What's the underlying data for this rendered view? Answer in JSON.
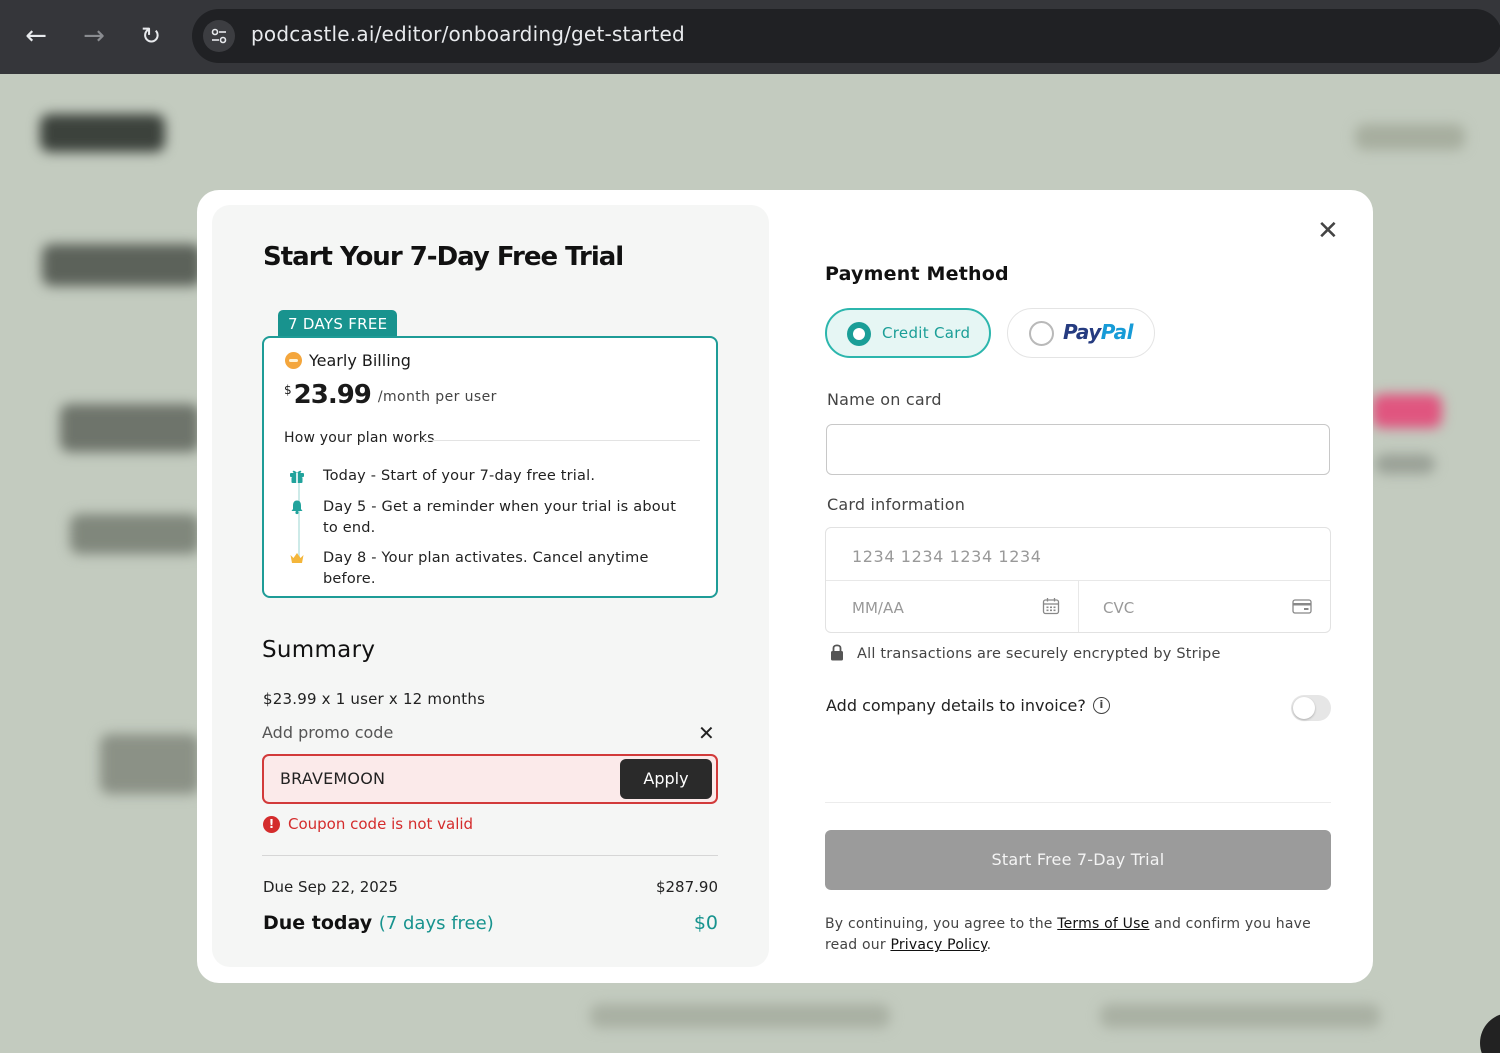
{
  "browser": {
    "url": "podcastle.ai/editor/onboarding/get-started"
  },
  "modal": {
    "title": "Start Your 7-Day Free Trial",
    "plan": {
      "tag": "7 DAYS FREE",
      "billing_label": "Yearly Billing",
      "currency": "$",
      "price": "23.99",
      "price_suffix": "/month per user",
      "how_label": "How your plan works",
      "steps": [
        {
          "icon": "gift-icon",
          "text": "Today - Start of your 7-day free trial."
        },
        {
          "icon": "bell-icon",
          "text": "Day 5 - Get a reminder when your trial is about to end."
        },
        {
          "icon": "crown-icon",
          "text": "Day 8 - Your plan activates. Cancel anytime before."
        }
      ]
    },
    "summary": {
      "title": "Summary",
      "line": "$23.99 x 1 user x 12 months",
      "promo_label": "Add promo code",
      "promo_value": "BRAVEMOON",
      "apply_label": "Apply",
      "error_text": "Coupon code is not valid",
      "due_date_label": "Due Sep 22, 2025",
      "due_date_amount": "$287.90",
      "due_today_label": "Due today",
      "due_today_free": "(7 days free)",
      "due_today_amount": "$0"
    },
    "payment": {
      "title": "Payment Method",
      "credit_card_label": "Credit Card",
      "paypal_pay": "Pay",
      "paypal_pal": "Pal",
      "name_label": "Name on card",
      "name_value": "",
      "card_label": "Card information",
      "card_number_placeholder": "1234 1234 1234 1234",
      "expiry_placeholder": "MM/AA",
      "cvc_placeholder": "CVC",
      "secure_text": "All transactions are securely encrypted by Stripe",
      "company_label": "Add company details to invoice?",
      "company_toggle_on": false,
      "start_button": "Start Free 7-Day Trial",
      "legal_prefix": "By continuing, you agree to the ",
      "terms_link": "Terms of Use",
      "legal_middle": " and confirm you have read our ",
      "privacy_link": "Privacy Policy",
      "legal_suffix": "."
    }
  },
  "colors": {
    "accent": "#1a9e97",
    "error": "#d42c2c",
    "backdrop": "#c3cbbf"
  }
}
